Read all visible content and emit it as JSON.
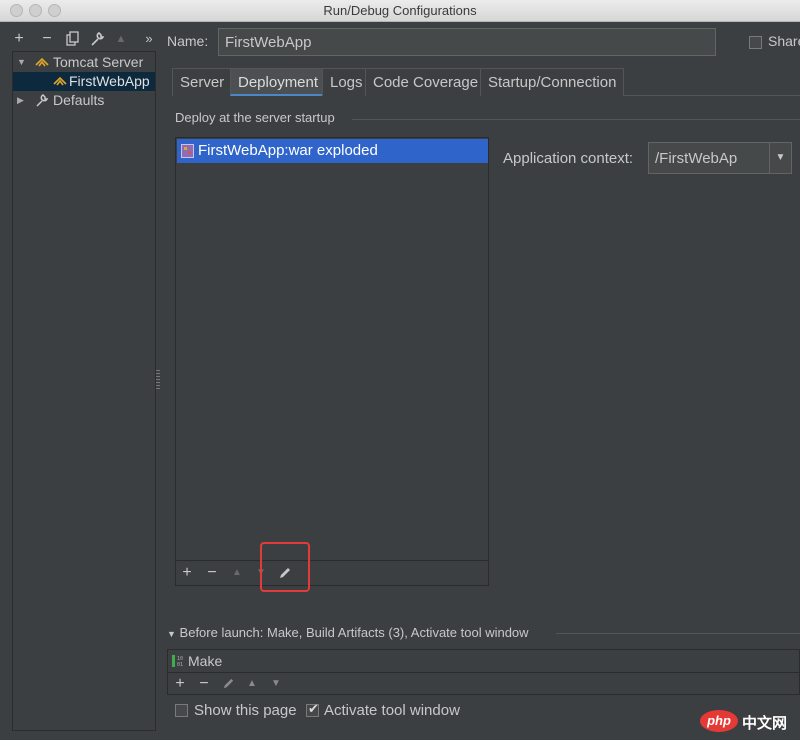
{
  "window": {
    "title": "Run/Debug Configurations"
  },
  "sidebar": {
    "toolbar": {
      "add": "+",
      "remove": "−",
      "more": "»"
    },
    "tree": [
      {
        "label": "Tomcat Server",
        "expanded": true
      },
      {
        "label": "FirstWebApp",
        "selected": true
      },
      {
        "label": "Defaults",
        "expanded": false
      }
    ]
  },
  "config": {
    "name_label": "Name:",
    "name_value": "FirstWebApp",
    "share_label": "Share"
  },
  "tabs": [
    "Server",
    "Deployment",
    "Logs",
    "Code Coverage",
    "Startup/Connection"
  ],
  "active_tab": "Deployment",
  "deployment": {
    "section_label": "Deploy at the server startup",
    "artifacts": [
      "FirstWebApp:war exploded"
    ],
    "toolbar": {
      "add": "+",
      "remove": "−"
    },
    "context_label": "Application context:",
    "context_value": "/FirstWebAp"
  },
  "before_launch": {
    "header": "Before launch: Make, Build Artifacts (3), Activate tool window",
    "tasks": [
      "Make"
    ],
    "toolbar": {
      "add": "+",
      "remove": "−"
    },
    "show_page_label": "Show this page",
    "show_page_checked": false,
    "activate_tool_window_label": "Activate tool window",
    "activate_tool_window_checked": true
  },
  "watermark": {
    "logo_text": "php",
    "site_text": "中文网"
  },
  "colors": {
    "selection": "#2f65ca",
    "highlight_box": "#e33a3a",
    "tab_underline": "#4a88c7"
  }
}
